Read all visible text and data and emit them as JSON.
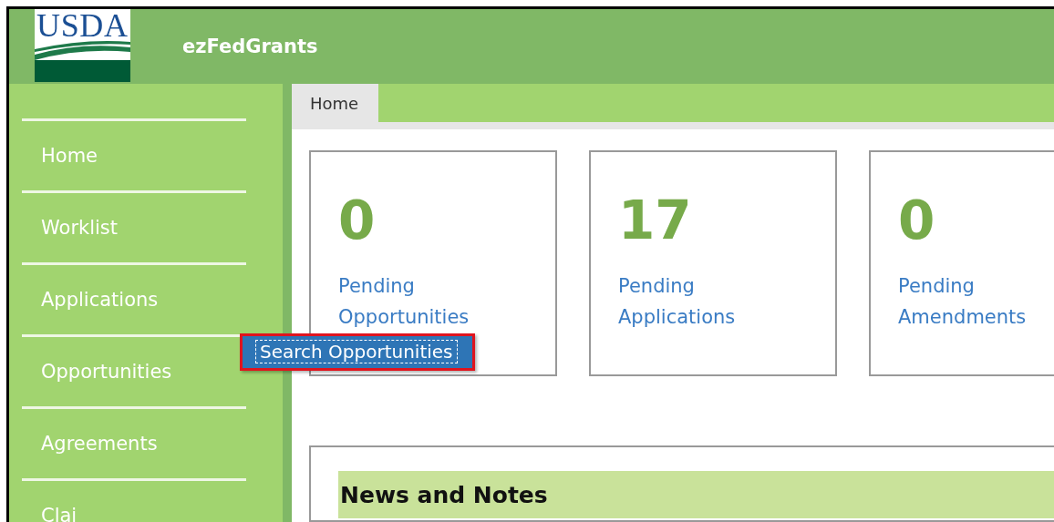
{
  "header": {
    "logo_text": "USDA",
    "title": "ezFedGrants"
  },
  "sidebar": {
    "items": [
      {
        "label": "Home"
      },
      {
        "label": "Worklist"
      },
      {
        "label": "Applications"
      },
      {
        "label": "Opportunities"
      },
      {
        "label": "Agreements"
      },
      {
        "label": "Clai"
      }
    ]
  },
  "submenu": {
    "items": [
      {
        "label": "Search Opportunities",
        "focused": true
      }
    ]
  },
  "tabs": [
    {
      "label": "Home",
      "selected": true
    }
  ],
  "cards": [
    {
      "count": "0",
      "link": "Pending Opportunities"
    },
    {
      "count": "17",
      "link": "Pending Applications"
    },
    {
      "count": "0",
      "link": "Pending Amendments"
    }
  ],
  "news": {
    "title": "News and Notes"
  }
}
